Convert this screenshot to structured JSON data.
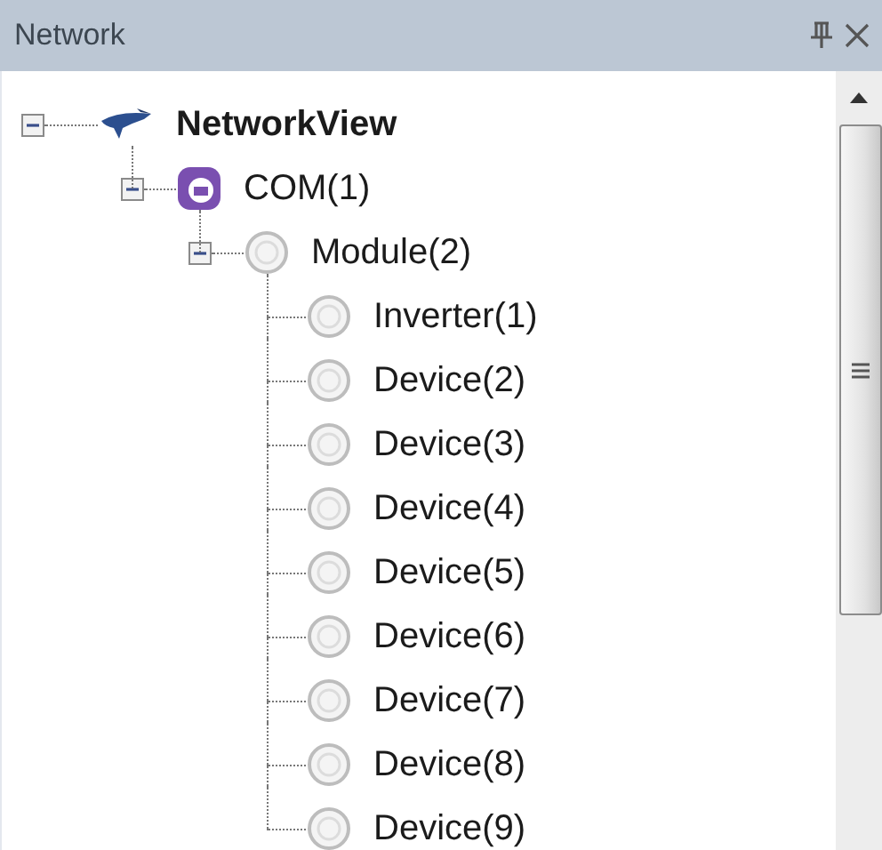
{
  "panel": {
    "title": "Network"
  },
  "tree": [
    {
      "kind": "network",
      "label": "NetworkView",
      "expanded": true,
      "children": [
        {
          "kind": "com",
          "label": "COM(1)",
          "expanded": true,
          "children": [
            {
              "kind": "module",
              "label": "Module(2)",
              "expanded": true,
              "children": [
                {
                  "kind": "device",
                  "label": "Inverter(1)"
                },
                {
                  "kind": "device",
                  "label": "Device(2)"
                },
                {
                  "kind": "device",
                  "label": "Device(3)"
                },
                {
                  "kind": "device",
                  "label": "Device(4)"
                },
                {
                  "kind": "device",
                  "label": "Device(5)"
                },
                {
                  "kind": "device",
                  "label": "Device(6)"
                },
                {
                  "kind": "device",
                  "label": "Device(7)"
                },
                {
                  "kind": "device",
                  "label": "Device(8)"
                },
                {
                  "kind": "device",
                  "label": "Device(9)"
                }
              ]
            }
          ]
        }
      ]
    }
  ]
}
